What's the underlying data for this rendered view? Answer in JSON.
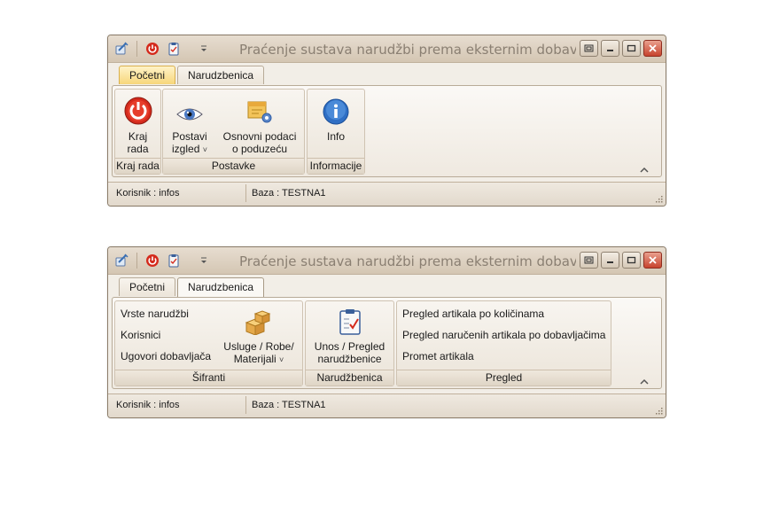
{
  "window1": {
    "title": "Praćenje sustava narudžbi prema eksternim dobavljačim...",
    "tabs": [
      "Početni",
      "Narudzbenica"
    ],
    "groups": {
      "kraj": {
        "label": "Kraj rada",
        "button": [
          "Kraj",
          "rada"
        ]
      },
      "postavke": {
        "label": "Postavke",
        "postavi": [
          "Postavi",
          "izgled"
        ],
        "podaci": [
          "Osnovni podaci",
          "o poduzeću"
        ]
      },
      "informacije": {
        "label": "Informacije",
        "info": "Info"
      }
    },
    "status": {
      "user": "Korisnik : infos",
      "db": "Baza : TESTNA1"
    }
  },
  "window2": {
    "title": "Praćenje sustava narudžbi prema eksternim dobavljačim...",
    "tabs": [
      "Početni",
      "Narudzbenica"
    ],
    "groups": {
      "sifranti": {
        "label": "Šifranti",
        "items": [
          "Vrste narudžbi",
          "Korisnici",
          "Ugovori dobavljača"
        ],
        "usluge": [
          "Usluge / Robe/",
          "Materijali"
        ]
      },
      "narudzbenica": {
        "label": "Narudžbenica",
        "unos": [
          "Unos / Pregled",
          "narudžbenice"
        ]
      },
      "pregled": {
        "label": "Pregled",
        "items": [
          "Pregled artikala po količinama",
          "Pregled naručenih artikala po dobavljačima",
          "Promet artikala"
        ]
      }
    },
    "status": {
      "user": "Korisnik : infos",
      "db": "Baza : TESTNA1"
    }
  },
  "icons": {
    "app": "app-icon",
    "power": "power-icon",
    "clipboard": "clipboard-icon",
    "qat_menu": "qat-dropdown-icon",
    "eye": "eye-icon",
    "company": "company-settings-icon",
    "info": "info-icon",
    "boxes": "boxes-icon",
    "order": "order-clipboard-icon",
    "restore": "restore-icon",
    "minimize": "minimize-icon",
    "maximize": "maximize-icon",
    "close": "close-icon",
    "collapse": "collapse-ribbon-icon",
    "grip": "resize-grip-icon"
  },
  "colors": {
    "power_red": "#d42a1c",
    "info_blue": "#2f6fc4",
    "tab_active_yellow": "#f7d67a",
    "close_red": "#c7432d"
  }
}
